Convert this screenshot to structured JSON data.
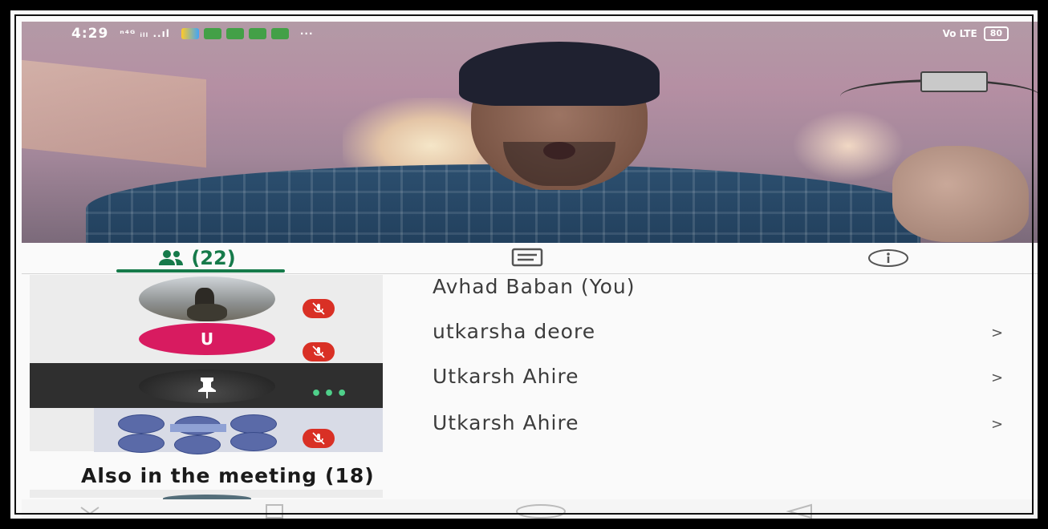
{
  "status_bar": {
    "time": "4:29",
    "signal_text": "ⁿ⁴ᴳ ᵢₗₗ ..ıl",
    "more": "···",
    "volte": "Vo LTE",
    "battery": "80",
    "app_icon_colors": [
      "#ffd54f",
      "#43a047",
      "#2e7d32",
      "#43a047",
      "#43a047",
      "#43a047"
    ]
  },
  "tabs": {
    "people_count": "(22)",
    "people_icon": "people-icon",
    "chat_icon": "chat-icon",
    "info_icon": "info-icon",
    "active_color": "#167a4a"
  },
  "tiles": [
    {
      "kind": "photo",
      "muted": true
    },
    {
      "kind": "letter",
      "letter": "U",
      "color": "#d81b60",
      "muted": true
    },
    {
      "kind": "pinned",
      "more": "•••"
    },
    {
      "kind": "screen-share",
      "muted": true
    }
  ],
  "participants": [
    {
      "name": "Avhad Baban (You)",
      "chevron": ""
    },
    {
      "name": "utkarsha deore",
      "chevron": ">"
    },
    {
      "name": "Utkarsh Ahire",
      "chevron": ">"
    },
    {
      "name": "Utkarsh Ahire",
      "chevron": ">"
    }
  ],
  "also_in_meeting": "Also in the meeting (18)",
  "nav": {
    "back": "back-icon",
    "home": "home-icon",
    "recents": "recents-icon"
  }
}
